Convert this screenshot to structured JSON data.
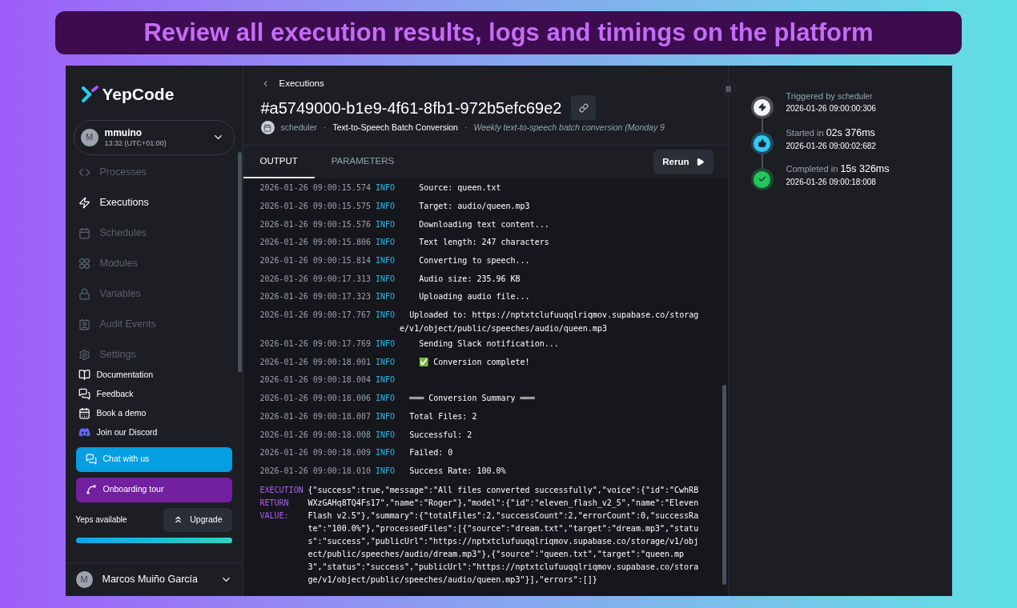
{
  "banner": {
    "title": "Review all execution results, logs and timings on the platform"
  },
  "sidebar": {
    "logo": "YepCode",
    "workspace": {
      "avatar": "M",
      "name": "mmuino",
      "time": "13:32 (UTC+01:00)"
    },
    "nav": [
      {
        "label": "Processes",
        "selected": false
      },
      {
        "label": "Executions",
        "selected": true
      },
      {
        "label": "Schedules",
        "selected": false
      },
      {
        "label": "Modules",
        "selected": false
      },
      {
        "label": "Variables",
        "selected": false
      },
      {
        "label": "Audit Events",
        "selected": false
      },
      {
        "label": "Settings",
        "selected": false
      }
    ],
    "links": [
      "Documentation",
      "Feedback",
      "Book a demo",
      "Join our Discord"
    ],
    "chat_button": "Chat with us",
    "tour_button": "Onboarding tour",
    "yeps": {
      "label": "Yeps available",
      "upgrade": "Upgrade",
      "level": 1.0
    },
    "user": {
      "avatar": "M",
      "name": "Marcos Muiño García"
    }
  },
  "header": {
    "back": "Executions",
    "title": "#a5749000-b1e9-4f61-8fb1-972b5efc69e2",
    "trigger": "scheduler",
    "separators": [
      "·",
      "·"
    ],
    "process": "Text-to-Speech Batch Conversion",
    "description": "Weekly text-to-speech batch conversion (Monday 9"
  },
  "tabs": [
    {
      "label": "OUTPUT",
      "selected": true
    },
    {
      "label": "PARAMETERS",
      "selected": false
    }
  ],
  "rerun": "Rerun",
  "logs": [
    {
      "time": "2026-01-26 09:00:15.574",
      "level": "INFO",
      "message": "    Source: queen.txt"
    },
    {
      "time": "2026-01-26 09:00:15.575",
      "level": "INFO",
      "message": "    Target: audio/queen.mp3"
    },
    {
      "time": "2026-01-26 09:00:15.576",
      "level": "INFO",
      "message": "    Downloading text content..."
    },
    {
      "time": "2026-01-26 09:00:15.806",
      "level": "INFO",
      "message": "    Text length: 247 characters"
    },
    {
      "time": "2026-01-26 09:00:15.814",
      "level": "INFO",
      "message": "    Converting to speech..."
    },
    {
      "time": "2026-01-26 09:00:17.313",
      "level": "INFO",
      "message": "    Audio size: 235.96 KB"
    },
    {
      "time": "2026-01-26 09:00:17.323",
      "level": "INFO",
      "message": "    Uploading audio file..."
    },
    {
      "time": "2026-01-26 09:00:17.767",
      "level": "INFO",
      "message": "  Uploaded to: https://nptxtclufuuqqlriqmov.supabase.co/storage/v1/object/public/speeches/audio/queen.mp3"
    },
    {
      "time": "2026-01-26 09:00:17.769",
      "level": "INFO",
      "message": "    Sending Slack notification..."
    },
    {
      "time": "2026-01-26 09:00:18.001",
      "level": "INFO",
      "message": "    ✅ Conversion complete!"
    },
    {
      "time": "2026-01-26 09:00:18.004",
      "level": "INFO"
    },
    {
      "time": "2026-01-26 09:00:18.006",
      "level": "INFO",
      "message": "  ═══ Conversion Summary ═══"
    },
    {
      "time": "2026-01-26 09:00:18.007",
      "level": "INFO",
      "message": "  Total Files: 2"
    },
    {
      "time": "2026-01-26 09:00:18.008",
      "level": "INFO",
      "message": "  Successful: 2"
    },
    {
      "time": "2026-01-26 09:00:18.009",
      "level": "INFO",
      "message": "  Failed: 0"
    },
    {
      "time": "2026-01-26 09:00:18.010",
      "level": "INFO",
      "message": "  Success Rate: 100.0%"
    }
  ],
  "return_value": {
    "label": "EXECUTION RETURN VALUE:",
    "value": "{\"success\":true,\"message\":\"All files converted successfully\",\"voice\":{\"id\":\"CwhRBWXzGAHq8TQ4Fs17\",\"name\":\"Roger\"},\"model\":{\"id\":\"eleven_flash_v2_5\",\"name\":\"Eleven Flash v2.5\"},\"summary\":{\"totalFiles\":2,\"successCount\":2,\"errorCount\":0,\"successRate\":\"100.0%\"},\"processedFiles\":[{\"source\":\"dream.txt\",\"target\":\"dream.mp3\",\"status\":\"success\",\"publicUrl\":\"https://nptxtclufuuqqlriqmov.supabase.co/storage/v1/object/public/speeches/audio/dream.mp3\"},{\"source\":\"queen.txt\",\"target\":\"queen.mp3\",\"status\":\"success\",\"publicUrl\":\"https://nptxtclufuuqqlriqmov.supabase.co/storage/v1/object/public/speeches/audio/queen.mp3\"}],\"errors\":[]}"
  },
  "timeline": [
    {
      "kind": "trigger",
      "label": "Triggered by",
      "value": "scheduler",
      "timestamp": "2026-01-26 09:00:00:306"
    },
    {
      "kind": "start",
      "label": "Started in",
      "value": "02s 376ms",
      "timestamp": "2026-01-26 09:00:02:682"
    },
    {
      "kind": "complete",
      "label": "Completed in",
      "value": "15s 326ms",
      "timestamp": "2026-01-26 09:00:18:008"
    }
  ]
}
